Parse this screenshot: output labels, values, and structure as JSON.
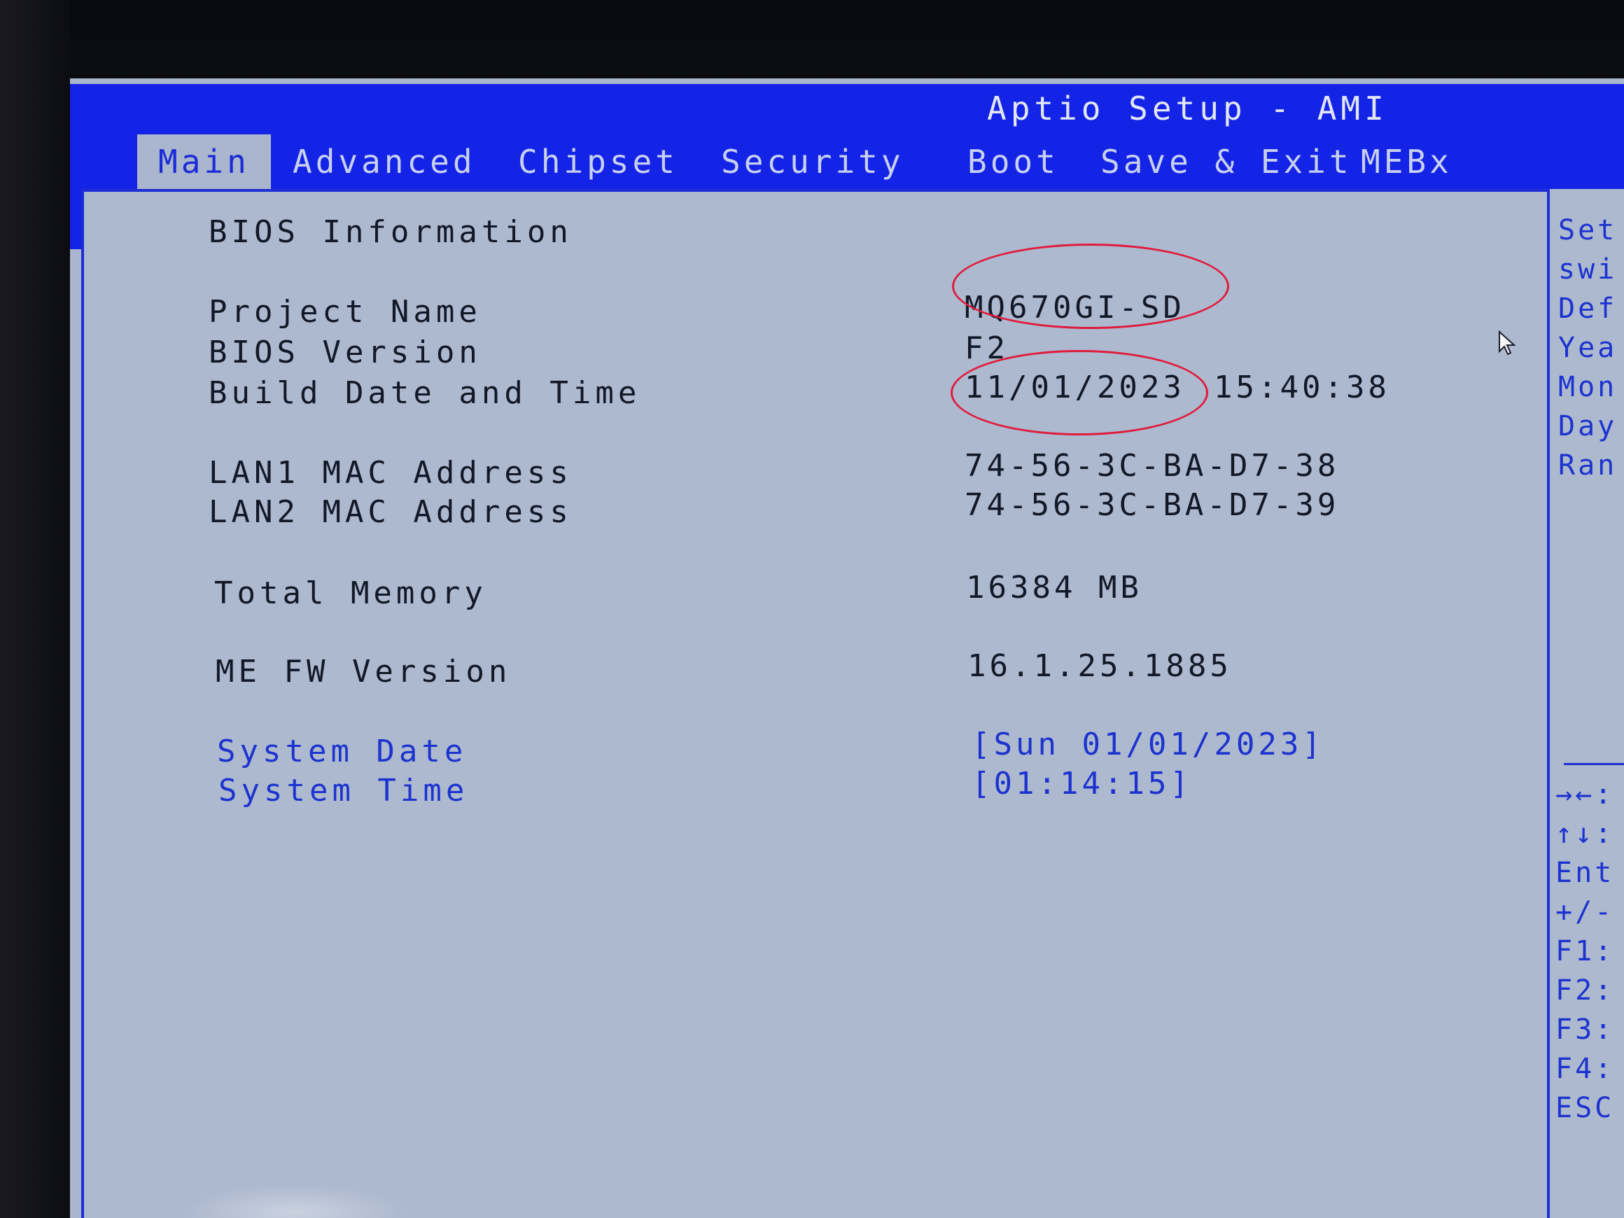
{
  "app_title": "Aptio Setup - AMI",
  "tabs": [
    {
      "label": "Main",
      "active": true
    },
    {
      "label": "Advanced"
    },
    {
      "label": "Chipset"
    },
    {
      "label": "Security"
    },
    {
      "label": "Boot"
    },
    {
      "label": "Save & Exit"
    },
    {
      "label": "MEBx"
    }
  ],
  "main": {
    "section_title": "BIOS Information",
    "rows": [
      {
        "label": "Project Name",
        "value": "MQ670GI-SD"
      },
      {
        "label": "BIOS Version",
        "value": "F2"
      },
      {
        "label": "Build Date and Time",
        "value": "11/01/2023",
        "value_extra": "15:40:38"
      },
      {
        "label": "LAN1 MAC Address",
        "value": "74-56-3C-BA-D7-38"
      },
      {
        "label": "LAN2 MAC Address",
        "value": "74-56-3C-BA-D7-39"
      },
      {
        "label": "Total Memory",
        "value": "16384 MB"
      },
      {
        "label": "ME FW Version",
        "value": "16.1.25.1885"
      }
    ],
    "settings": [
      {
        "label": "System Date",
        "value": "[Sun 01/01/2023]"
      },
      {
        "label": "System Time",
        "value": "[01:14:15]"
      }
    ]
  },
  "help_pane": {
    "lines": [
      "Set",
      "swi",
      "Def",
      "Yea",
      "Mon",
      "Day",
      "Ran"
    ],
    "keys": [
      "→←:",
      "↑↓:",
      "Ent",
      "+/-",
      "F1:",
      "F2:",
      "F3:",
      "F4:",
      "ESC"
    ]
  },
  "colors": {
    "header_blue": "#1424e6",
    "panel_bg": "#adb9cf",
    "selectable_text": "#1c33cf",
    "annotation_red": "#e01b3c"
  }
}
